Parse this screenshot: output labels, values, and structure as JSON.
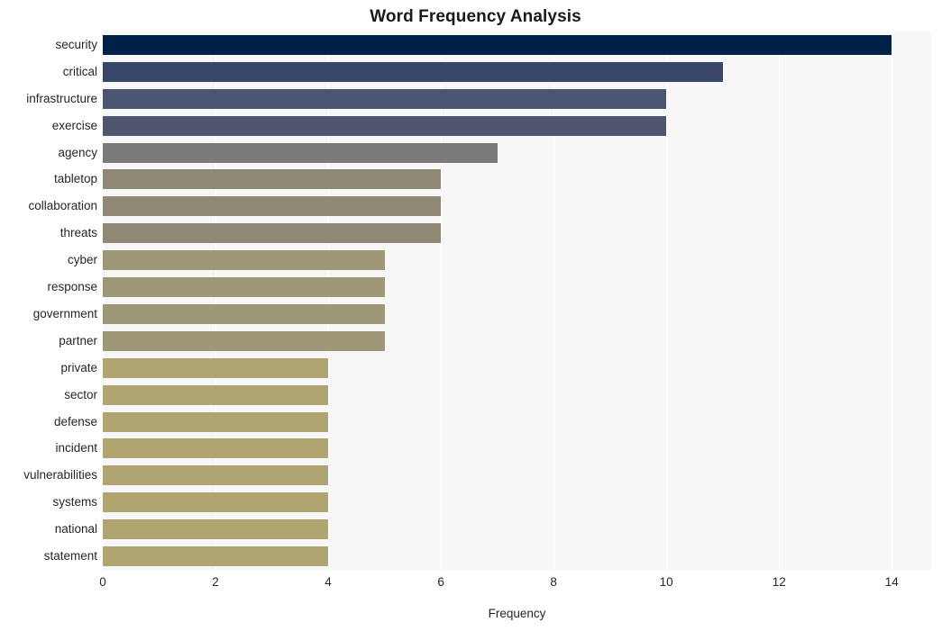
{
  "chart_data": {
    "type": "bar",
    "orientation": "horizontal",
    "title": "Word Frequency Analysis",
    "xlabel": "Frequency",
    "ylabel": "",
    "xlim": [
      0,
      14.7
    ],
    "ylim": [
      0,
      20
    ],
    "xticks": [
      0,
      2,
      4,
      6,
      8,
      10,
      12,
      14
    ],
    "xtick_labels": [
      "0",
      "2",
      "4",
      "6",
      "8",
      "10",
      "12",
      "14"
    ],
    "grid": "vertical-white-on-lightgrey",
    "legend": "none",
    "categories": [
      "security",
      "critical",
      "infrastructure",
      "exercise",
      "agency",
      "tabletop",
      "collaboration",
      "threats",
      "cyber",
      "response",
      "government",
      "partner",
      "private",
      "sector",
      "defense",
      "incident",
      "vulnerabilities",
      "systems",
      "national",
      "statement"
    ],
    "values": [
      14,
      11,
      10,
      10,
      7,
      6,
      6,
      6,
      5,
      5,
      5,
      5,
      4,
      4,
      4,
      4,
      4,
      4,
      4,
      4
    ],
    "bar_colors": [
      "#002147",
      "#384669",
      "#4b5470",
      "#4e566f",
      "#7c7a78",
      "#8e8875",
      "#8f8975",
      "#8e8874",
      "#9d9777",
      "#9d9777",
      "#9d9777",
      "#9d9777",
      "#b0a471",
      "#b0a471",
      "#b0a471",
      "#b0a471",
      "#b0a471",
      "#b0a471",
      "#b0a471",
      "#b0a471"
    ]
  },
  "style": {
    "figure_background": "#ffffff",
    "axes_background": "#f7f7f7",
    "gridline_color": "#ffffff",
    "text_color": "#262626",
    "title_color": "#1a1a1a"
  }
}
